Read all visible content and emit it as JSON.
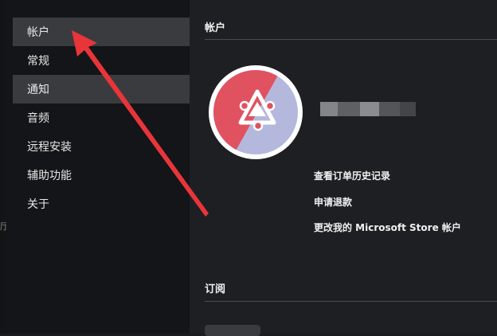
{
  "sidebar": {
    "items": [
      {
        "label": "帐户"
      },
      {
        "label": "常规"
      },
      {
        "label": "通知"
      },
      {
        "label": "音频"
      },
      {
        "label": "远程安装"
      },
      {
        "label": "辅助功能"
      },
      {
        "label": "关于"
      }
    ]
  },
  "edge_text": "厅",
  "account": {
    "section_title": "帐户",
    "links": {
      "order_history": "查看订单历史记录",
      "refund": "申请退款",
      "change_account": "更改我的 Microsoft Store 帐户"
    }
  },
  "subscription": {
    "section_title": "订阅"
  },
  "colors": {
    "avatar_red": "#e05260",
    "avatar_lavender": "#b5b8dd",
    "active_item": "#3a3b3e",
    "arrow": "#e8353a"
  },
  "icons": [
    "user-avatar-icon",
    "annotation-arrow"
  ]
}
